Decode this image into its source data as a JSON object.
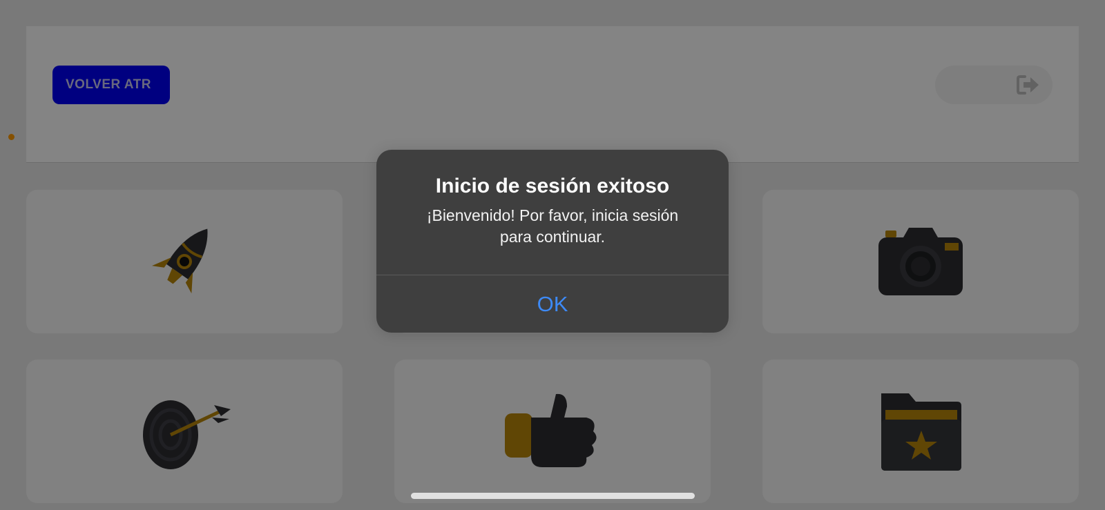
{
  "header": {
    "back_button_label": "VOLVER ATR",
    "logout_icon": "logout-icon"
  },
  "grid": {
    "cards": [
      {
        "icon": "rocket-icon"
      },
      {
        "icon": "hidden-card-icon"
      },
      {
        "icon": "camera-icon"
      },
      {
        "icon": "target-icon"
      },
      {
        "icon": "thumbs-up-icon"
      },
      {
        "icon": "star-folder-icon"
      }
    ]
  },
  "alert": {
    "title": "Inicio de sesión exitoso",
    "message_line1": "¡Bienvenido! Por favor, inicia sesión",
    "message_line2": "para continuar.",
    "ok_label": "OK"
  },
  "colors": {
    "accent_blue": "#0000f5",
    "alert_bg": "#3f3f3f",
    "alert_button": "#3d8af7",
    "indicator_dot": "#ff9a00",
    "icon_dark": "#2c2d31",
    "icon_gold": "#b8860b"
  }
}
